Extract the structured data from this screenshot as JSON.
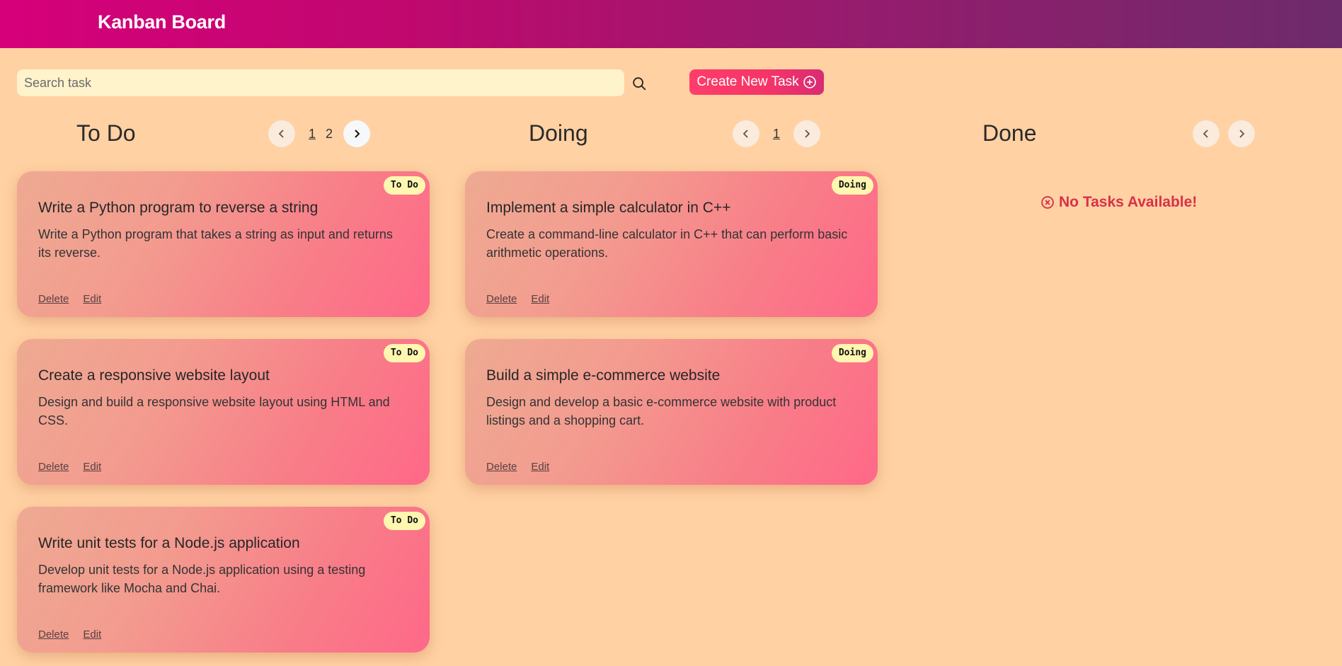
{
  "header": {
    "title": "Kanban Board"
  },
  "toolbar": {
    "search_placeholder": "Search task",
    "search_value": "",
    "create_label": "Create New Task"
  },
  "columns": [
    {
      "title": "To Do",
      "pages": [
        "1",
        "2"
      ],
      "current_page": "1"
    },
    {
      "title": "Doing",
      "pages": [
        "1"
      ],
      "current_page": "1"
    },
    {
      "title": "Done",
      "pages": [],
      "empty_message": "No Tasks Available!"
    }
  ],
  "todo_cards": [
    {
      "badge": "To Do",
      "title": "Write a Python program to reverse a string",
      "description": "Write a Python program that takes a string as input and returns its reverse.",
      "delete_label": "Delete",
      "edit_label": "Edit"
    },
    {
      "badge": "To Do",
      "title": "Create a responsive website layout",
      "description": "Design and build a responsive website layout using HTML and CSS.",
      "delete_label": "Delete",
      "edit_label": "Edit"
    },
    {
      "badge": "To Do",
      "title": "Write unit tests for a Node.js application",
      "description": "Develop unit tests for a Node.js application using a testing framework like Mocha and Chai.",
      "delete_label": "Delete",
      "edit_label": "Edit"
    }
  ],
  "doing_cards": [
    {
      "badge": "Doing",
      "title": "Implement a simple calculator in C++",
      "description": "Create a command-line calculator in C++ that can perform basic arithmetic operations.",
      "delete_label": "Delete",
      "edit_label": "Edit"
    },
    {
      "badge": "Doing",
      "title": "Build a simple e-commerce website",
      "description": "Design and develop a basic e-commerce website with product listings and a shopping cart.",
      "delete_label": "Delete",
      "edit_label": "Edit"
    }
  ],
  "colors": {
    "header_start": "#d6007a",
    "header_end": "#6d2b6b",
    "background": "#ffd1a3",
    "accent": "#f43468",
    "empty_text": "#d93048",
    "badge": "#fff6b0"
  }
}
